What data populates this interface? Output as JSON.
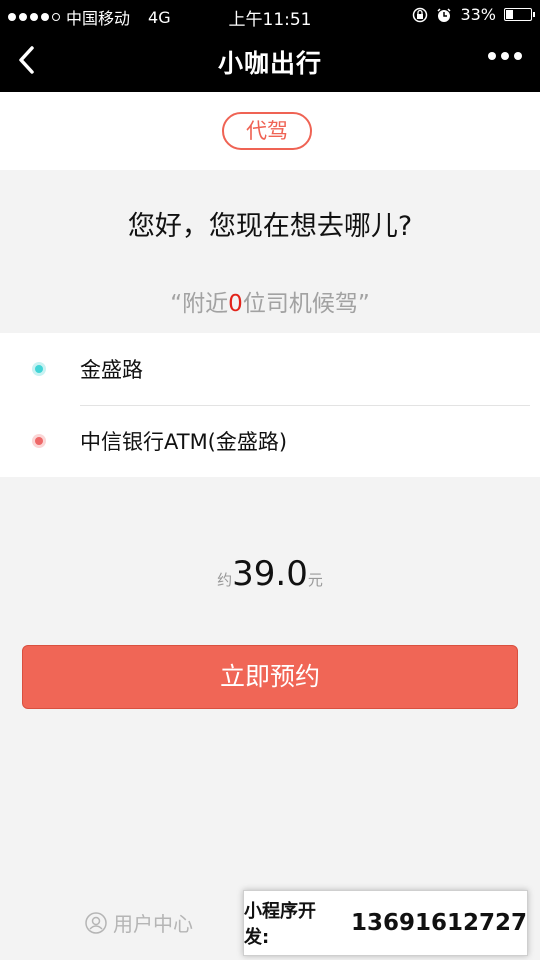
{
  "status_bar": {
    "carrier": "中国移动",
    "network": "4G",
    "time": "上午11:51",
    "battery": "33%",
    "battery_level": 0.33
  },
  "nav": {
    "title": "小咖出行",
    "back_icon": "chevron-left-icon",
    "more_icon": "more-dots-icon"
  },
  "tab": {
    "label": "代驾"
  },
  "greeting": "您好，您现在想去哪儿?",
  "drivers": {
    "prefix": "“附近",
    "count": "0",
    "suffix": "位司机候驾”"
  },
  "addresses": {
    "from": "金盛路",
    "to": "中信银行ATM(金盛路)"
  },
  "price": {
    "prefix": "约",
    "amount": "39.0",
    "unit": "元"
  },
  "book_button": "立即预约",
  "footer": {
    "user_center": "用户中心",
    "ad_label": "小程序开发:",
    "ad_phone": "13691612727"
  },
  "colors": {
    "accent": "#f06656",
    "start_marker": "#42d4d6",
    "end_marker": "#ee6868",
    "driver_count": "#e2231a"
  }
}
